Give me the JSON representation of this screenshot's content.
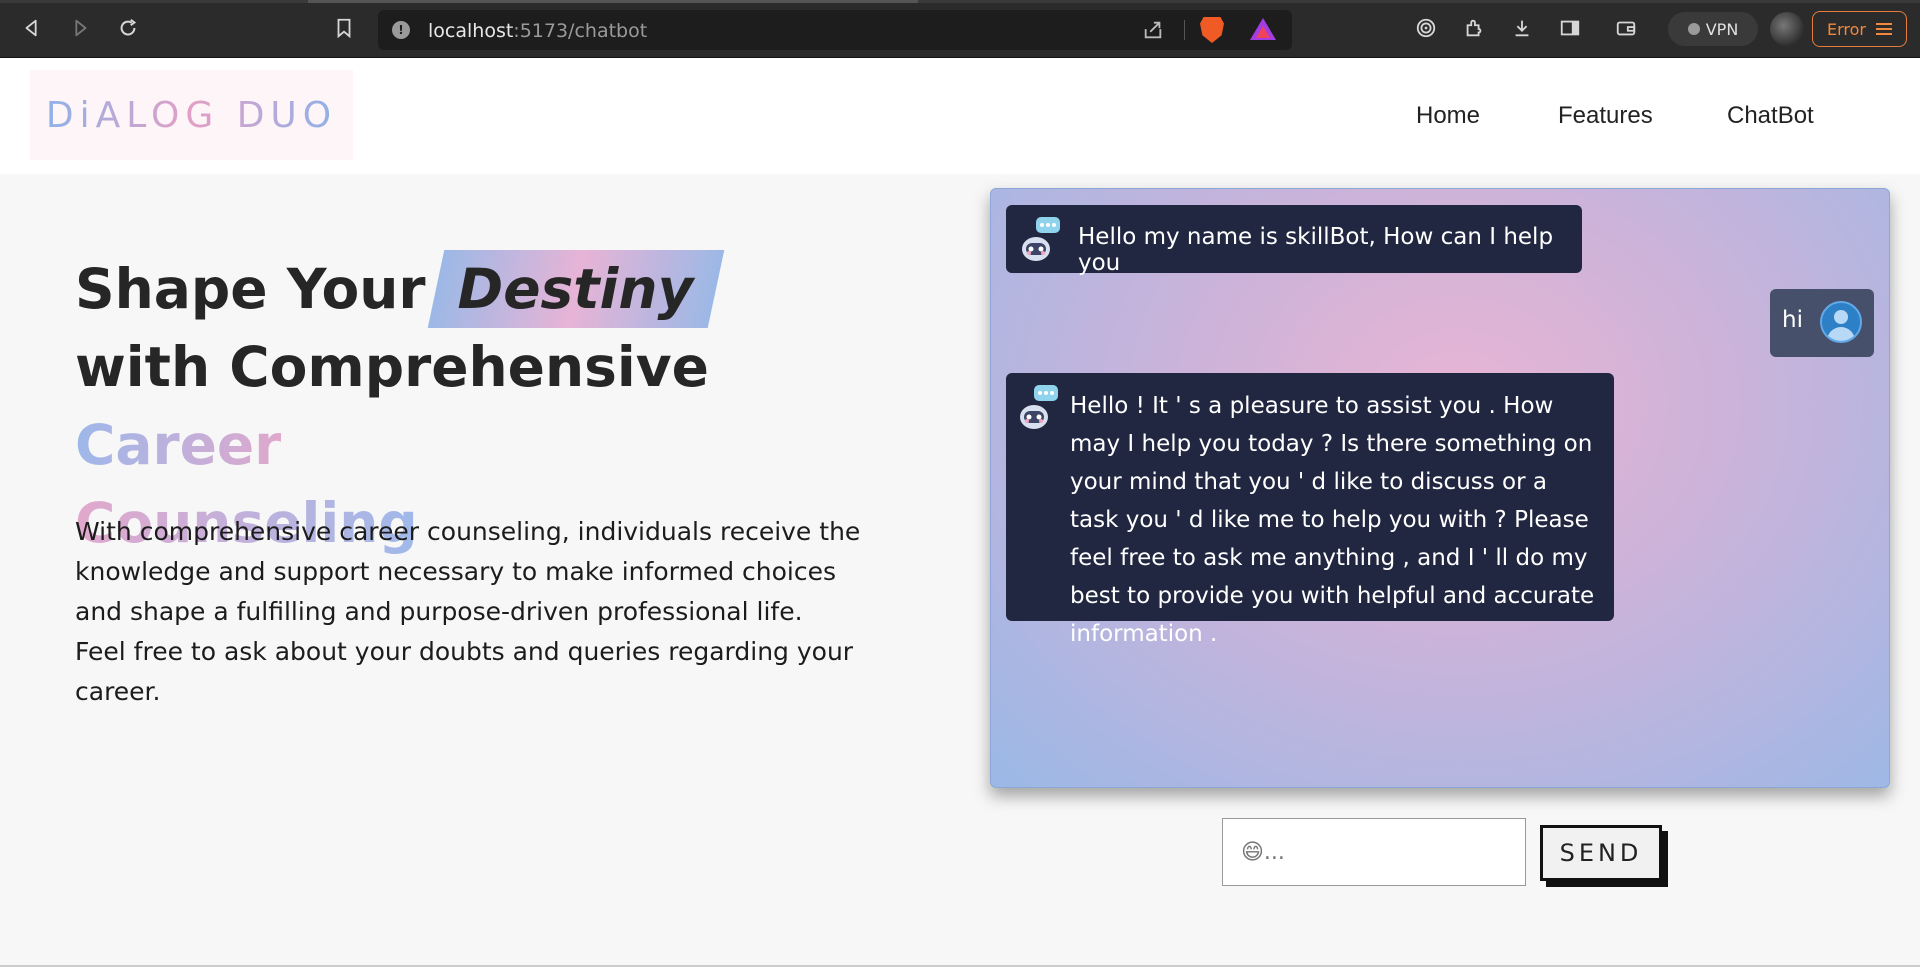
{
  "browser": {
    "url_host": "localhost",
    "url_path": ":5173/chatbot",
    "vpn_label": "VPN",
    "error_label": "Error"
  },
  "header": {
    "logo_text": "DiALOG DUO",
    "nav": [
      "Home",
      "Features",
      "ChatBot"
    ]
  },
  "hero": {
    "title_part1": "Shape Your",
    "title_highlight": "Destiny",
    "title_part2": "with Comprehensive",
    "title_career": "Career",
    "title_counseling": "Counseling",
    "description_1": "With comprehensive career counseling, individuals receive the knowledge and support necessary to make informed choices and shape a fulfilling and purpose-driven professional life.",
    "description_2": "Feel free to ask about your doubts and queries regarding your career."
  },
  "chat": {
    "messages": [
      {
        "sender": "bot",
        "text": "Hello my name is skillBot, How can I help you"
      },
      {
        "sender": "user",
        "text": "hi"
      },
      {
        "sender": "bot",
        "text": "Hello ! It ' s a pleasure to assist you . How may I help you today ? Is there something on your mind that you ' d like to discuss or a task you ' d like me to help you with ? Please feel free to ask me anything , and I ' ll do my best to provide you with helpful and accurate information ."
      }
    ],
    "input_placeholder": "😄...",
    "send_label": "SEND"
  },
  "colors": {
    "chat_bubble_bot": "#212741",
    "chat_bubble_user": "#46506b",
    "accent_blue": "#9cb8e6",
    "accent_pink": "#e7b4d6",
    "error_orange": "#f0883e"
  }
}
